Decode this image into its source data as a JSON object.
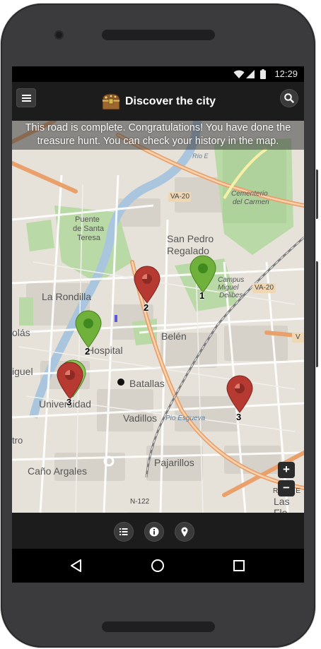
{
  "status_bar": {
    "time": "12:29",
    "icons": [
      "wifi-icon",
      "signal-icon",
      "battery-icon"
    ]
  },
  "app_bar": {
    "title": "Discover the city",
    "logo_icon": "treasure-chest-icon",
    "menu_icon": "hamburger-icon",
    "search_icon": "search-icon"
  },
  "banner": {
    "text": "This road is complete. Congratulations! You have done the treasure hunt. You can check your history in the map."
  },
  "map": {
    "labels": {
      "puente_1": "Puente",
      "puente_2": "de Santa",
      "puente_3": "Teresa",
      "la_rondilla": "La Rondilla",
      "olas": "olás",
      "iguel": "iguel",
      "tro": "tro",
      "san_pedro": "San Pedro",
      "regalado": "Regalado",
      "campus_1": "Campus",
      "campus_2": "Miguel",
      "campus_3": "Delibes",
      "cementerio_1": "Cementerio",
      "cementerio_2": "del Carmen",
      "va20_top": "VA-20",
      "va20_right": "VA-20",
      "hospital": "Hospital",
      "belen": "Belén",
      "batallas": "Batallas",
      "universidad": "Universidad",
      "vadillos": "Vadillos",
      "pio_esgueva": "Pio Esgueva",
      "pajarillos": "Pajarillos",
      "cano_argales": "Caño Argales",
      "n122": "N-122",
      "ronda": "Ronda E",
      "las_flo": "Las Flo",
      "rio": "Río E",
      "v_right": "V"
    },
    "markers": [
      {
        "color": "red",
        "number": "2"
      },
      {
        "color": "green",
        "number": "1"
      },
      {
        "color": "green",
        "number": "2"
      },
      {
        "color": "red",
        "number": "3"
      },
      {
        "color": "red",
        "number": "3"
      }
    ],
    "zoom_in": "+",
    "zoom_out": "−"
  },
  "bottom_bar": {
    "buttons": [
      "list-icon",
      "info-icon",
      "location-pin-icon"
    ]
  },
  "nav_bar": {
    "buttons": [
      "back-icon",
      "home-icon",
      "recents-icon"
    ]
  },
  "colors": {
    "marker_red": "#b73a32",
    "marker_green": "#6fb13a",
    "app_bar": "#1c1c1c",
    "road_orange": "#e9a06a"
  }
}
